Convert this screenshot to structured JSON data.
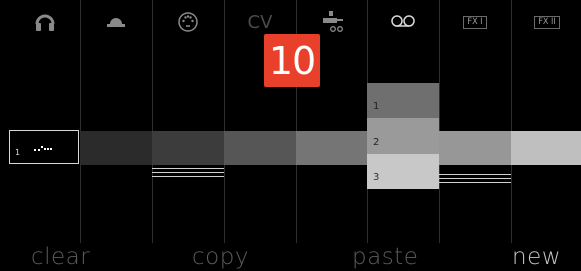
{
  "header": {
    "icons": [
      {
        "name": "headphones-icon"
      },
      {
        "name": "dome-icon"
      },
      {
        "name": "dial-icon"
      },
      {
        "name": "cv-label",
        "text": "CV"
      },
      {
        "name": "connector-icon"
      },
      {
        "name": "tape-icon"
      },
      {
        "name": "fx1-label",
        "text": "FX I"
      },
      {
        "name": "fx2-label",
        "text": "FX II"
      }
    ]
  },
  "badge": {
    "value": "10",
    "color": "#e8402a"
  },
  "track": {
    "selected_number": "1",
    "stack": [
      {
        "number": "1",
        "color": "#6f6f6f"
      },
      {
        "number": "2",
        "color": "#9a9a9a"
      },
      {
        "number": "3",
        "color": "#c8c8c8"
      }
    ]
  },
  "actions": {
    "clear": "clear",
    "copy": "copy",
    "paste": "paste",
    "new": "new"
  }
}
